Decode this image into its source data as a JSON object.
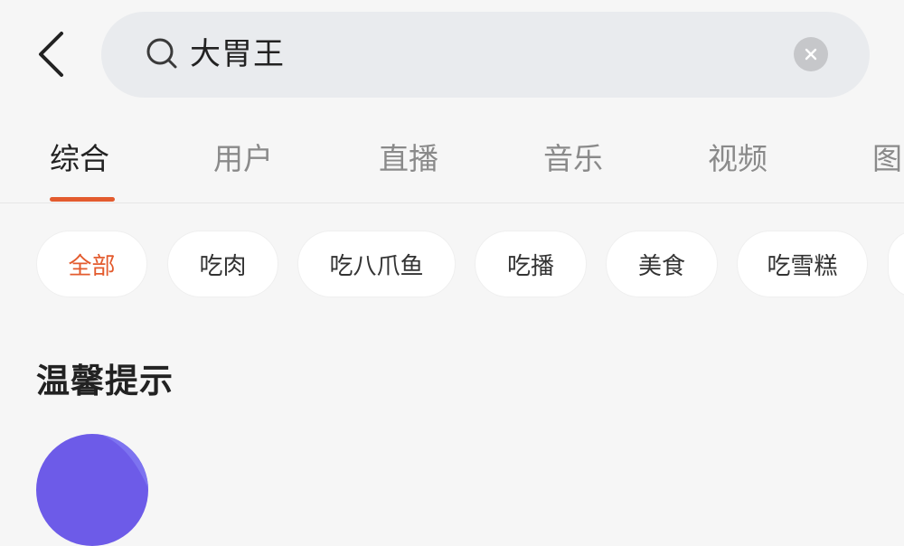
{
  "search": {
    "query": "大胃王"
  },
  "tabs": [
    {
      "label": "综合"
    },
    {
      "label": "用户"
    },
    {
      "label": "直播"
    },
    {
      "label": "音乐"
    },
    {
      "label": "视频"
    },
    {
      "label": "图"
    }
  ],
  "filters": [
    {
      "label": "全部"
    },
    {
      "label": "吃肉"
    },
    {
      "label": "吃八爪鱼"
    },
    {
      "label": "吃播"
    },
    {
      "label": "美食"
    },
    {
      "label": "吃雪糕"
    }
  ],
  "section": {
    "title": "温馨提示"
  },
  "colors": {
    "accent": "#e35b2e",
    "background": "#f6f6f6",
    "search_bg": "#e9ebee",
    "avatar": "#6d5be8"
  },
  "icons": {
    "back": "chevron-left-icon",
    "search": "search-icon",
    "clear": "close-icon"
  }
}
